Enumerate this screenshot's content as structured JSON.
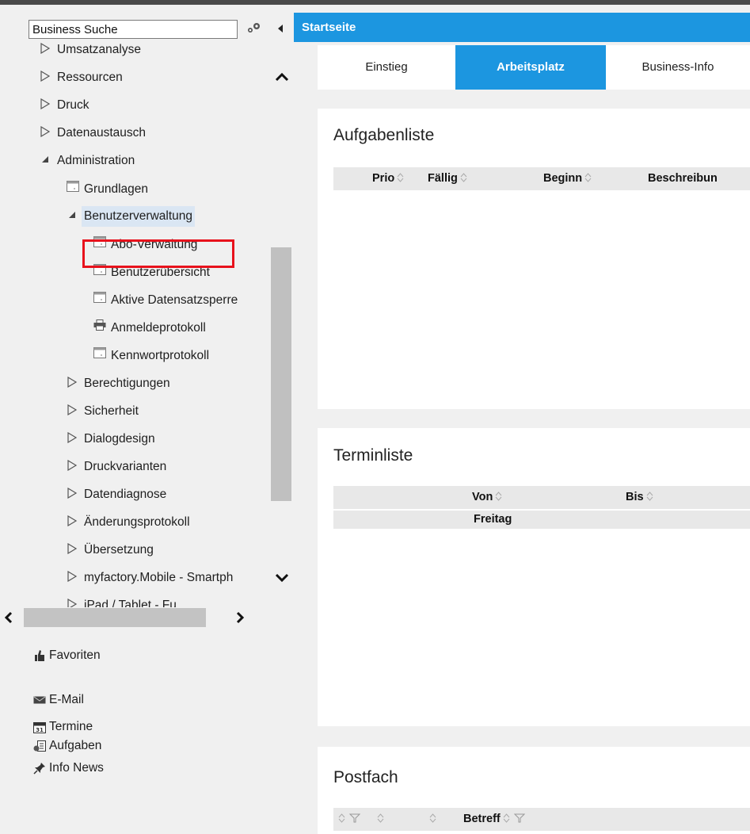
{
  "sidebar": {
    "search_value": "Business Suche",
    "tree": [
      {
        "label": "Umsatzanalyse",
        "state": "collapsed"
      },
      {
        "label": "Ressourcen",
        "state": "collapsed"
      },
      {
        "label": "Druck",
        "state": "collapsed"
      },
      {
        "label": "Datenaustausch",
        "state": "collapsed"
      },
      {
        "label": "Administration",
        "state": "expanded"
      },
      {
        "label": "Grundlagen",
        "state": "leaf"
      },
      {
        "label": "Benutzerverwaltung",
        "state": "expanded"
      },
      {
        "label": "Abo-Verwaltung",
        "state": "leaf"
      },
      {
        "label": "Benutzerübersicht",
        "state": "leaf"
      },
      {
        "label": "Aktive Datensatzsperre",
        "state": "leaf"
      },
      {
        "label": "Anmeldeprotokoll",
        "state": "leaf"
      },
      {
        "label": "Kennwortprotokoll",
        "state": "leaf"
      },
      {
        "label": "Berechtigungen",
        "state": "collapsed"
      },
      {
        "label": "Sicherheit",
        "state": "collapsed"
      },
      {
        "label": "Dialogdesign",
        "state": "collapsed"
      },
      {
        "label": "Druckvarianten",
        "state": "collapsed"
      },
      {
        "label": "Datendiagnose",
        "state": "collapsed"
      },
      {
        "label": "Änderungsprotokoll",
        "state": "collapsed"
      },
      {
        "label": "Übersetzung",
        "state": "collapsed"
      },
      {
        "label": "myfactory.Mobile - Smartph",
        "state": "collapsed"
      },
      {
        "label": "iPad / Tablet - Fu",
        "state": "collapsed"
      }
    ],
    "nav": {
      "favoriten": "Favoriten",
      "email": "E-Mail",
      "termine": "Termine",
      "aufgaben": "Aufgaben",
      "info_news": "Info News"
    }
  },
  "main": {
    "title": "Startseite",
    "tabs": [
      "Einstieg",
      "Arbeitsplatz",
      "Business-Info"
    ],
    "active_tab": "Arbeitsplatz",
    "aufgaben": {
      "title": "Aufgabenliste",
      "columns": [
        "Prio",
        "Fällig",
        "Beginn",
        "Beschreibun"
      ]
    },
    "termine": {
      "title": "Terminliste",
      "columns": [
        "Von",
        "Bis"
      ],
      "group_row": "Freitag"
    },
    "postfach": {
      "title": "Postfach",
      "columns": [
        "",
        "",
        "",
        "Betreff"
      ]
    }
  },
  "colors": {
    "accent": "#1c96e0",
    "highlight_border": "#e8121c",
    "selection": "#dae6f3"
  }
}
